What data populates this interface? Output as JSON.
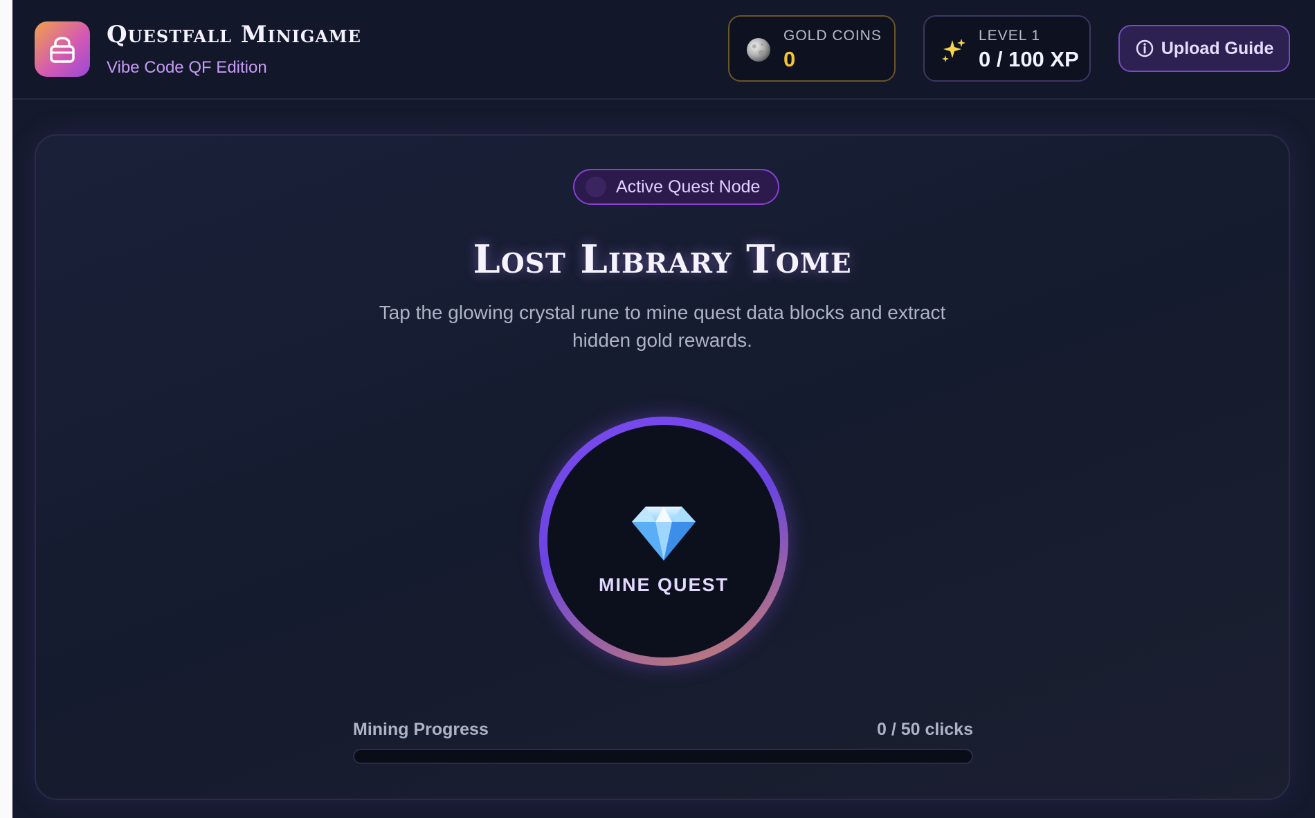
{
  "header": {
    "title": "Questfall Minigame",
    "subtitle": "Vibe Code QF Edition",
    "logo_icon": "lock-icon"
  },
  "stats": {
    "gold": {
      "label": "GOLD COINS",
      "value": "0",
      "icon": "moon-coin-icon"
    },
    "xp": {
      "label": "LEVEL 1",
      "value": "0 / 100 XP",
      "icon": "sparkles-icon"
    }
  },
  "upload_button": {
    "label": "Upload Guide",
    "icon": "info-icon"
  },
  "quest": {
    "badge": "Active Quest Node",
    "title": "Lost Library Tome",
    "description": "Tap the glowing crystal rune to mine quest data blocks and extract hidden gold rewards.",
    "mine_button_label": "MINE QUEST"
  },
  "progress": {
    "label": "Mining Progress",
    "count_text": "0 / 50 clicks",
    "current": 0,
    "total": 50
  },
  "colors": {
    "accent_purple": "#7a4bf0",
    "gold": "#f5c533",
    "background": "#141a2c"
  }
}
